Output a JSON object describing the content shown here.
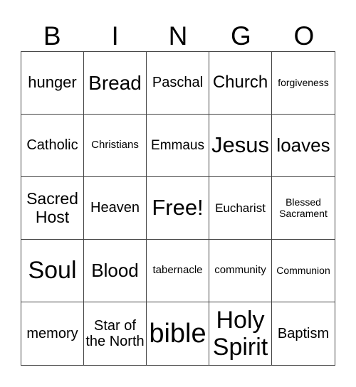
{
  "header": [
    "B",
    "I",
    "N",
    "G",
    "O"
  ],
  "cells": [
    {
      "text": "hunger",
      "size": "l"
    },
    {
      "text": "Bread",
      "size": "xl"
    },
    {
      "text": "Paschal",
      "size": "m"
    },
    {
      "text": "Church",
      "size": "l"
    },
    {
      "text": "forgiveness",
      "size": "xs"
    },
    {
      "text": "Catholic",
      "size": "m"
    },
    {
      "text": "Christians",
      "size": "s"
    },
    {
      "text": "Emmaus",
      "size": "m"
    },
    {
      "text": "Jesus",
      "size": "xxl"
    },
    {
      "text": "loaves",
      "size": "xl"
    },
    {
      "text": "Sacred Host",
      "size": "l"
    },
    {
      "text": "Heaven",
      "size": "m"
    },
    {
      "text": "Free!",
      "size": "xxl"
    },
    {
      "text": "Eucharist",
      "size": "s"
    },
    {
      "text": "Blessed Sacrament",
      "size": "xs"
    },
    {
      "text": "Soul",
      "size": "xxxl"
    },
    {
      "text": "Blood",
      "size": "xl"
    },
    {
      "text": "tabernacle",
      "size": "s"
    },
    {
      "text": "community",
      "size": "s"
    },
    {
      "text": "Communion",
      "size": "xs"
    },
    {
      "text": "memory",
      "size": "m"
    },
    {
      "text": "Star of the North",
      "size": "m"
    },
    {
      "text": "bible",
      "size": "xxxl"
    },
    {
      "text": "Holy Spirit",
      "size": "xxxl"
    },
    {
      "text": "Baptism",
      "size": "m"
    }
  ]
}
